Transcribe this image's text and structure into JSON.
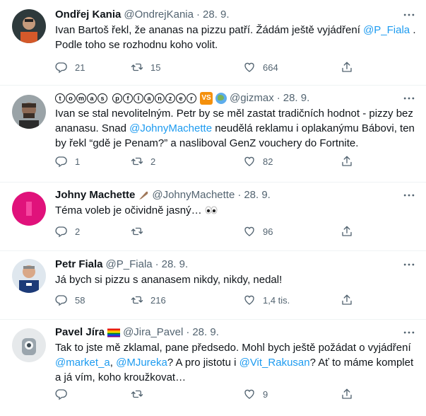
{
  "tweets": [
    {
      "name": "Ondřej Kania",
      "handle": "@OndrejKania",
      "dot": "·",
      "time": "28. 9.",
      "text_parts": [
        "Ivan Bartoš řekl, že ananas na pizzu patří. Žádám ještě vyjádření ",
        "@P_Fiala",
        " . Podle toho se rozhodnu koho volit."
      ],
      "reply_count": "21",
      "retweet_count": "15",
      "like_count": "664"
    },
    {
      "name_letters": [
        "t",
        "o",
        "m",
        "a",
        "s",
        "p",
        "f",
        "l",
        "a",
        "n",
        "z",
        "e",
        "r"
      ],
      "handle": "@gizmax",
      "dot": "·",
      "time": "28. 9.",
      "text_parts": [
        "Ivan se stal nevolitelným. Petr by se měl zastat tradičních hodnot - pizzy bez ananasu. Snad ",
        "@JohnyMachette",
        " neudělá reklamu i oplakanýmu Bábovi, ten by řekl “gdě je Penam?” a nasliboval GenZ vouchery do Fortnite."
      ],
      "reply_count": "1",
      "retweet_count": "2",
      "like_count": "82"
    },
    {
      "name": "Johny Machette",
      "handle": "@JohnyMachette",
      "dot": "·",
      "time": "28. 9.",
      "text": "Téma voleb je očividně jasný…",
      "reply_count": "2",
      "retweet_count": "",
      "like_count": "96"
    },
    {
      "name": "Petr Fiala",
      "handle": "@P_Fiala",
      "dot": "·",
      "time": "28. 9.",
      "text": "Já bych si pizzu s ananasem nikdy, nikdy, nedal!",
      "reply_count": "58",
      "retweet_count": "216",
      "like_count": "1,4 tis."
    },
    {
      "name": "Pavel Jíra",
      "handle": "@Jira_Pavel",
      "dot": "·",
      "time": "28. 9.",
      "text_parts": [
        "Tak to jste mě zklamal, pane předsedo. Mohl bych ještě požádat o vyjádření ",
        "@market_a",
        ", ",
        "@MJureka",
        "? A pro jistotu i ",
        "@Vit_Rakusan",
        "? Ať to máme komplet a já vím, koho kroužkovat…"
      ],
      "reply_count": "",
      "retweet_count": "",
      "like_count": "9"
    }
  ],
  "icons": [
    "reply-icon",
    "retweet-icon",
    "like-icon",
    "share-icon",
    "more-icon"
  ],
  "colors": {
    "link": "#1d9bf0",
    "muted": "#536471",
    "text": "#0f1419",
    "divider": "#eff3f4"
  }
}
